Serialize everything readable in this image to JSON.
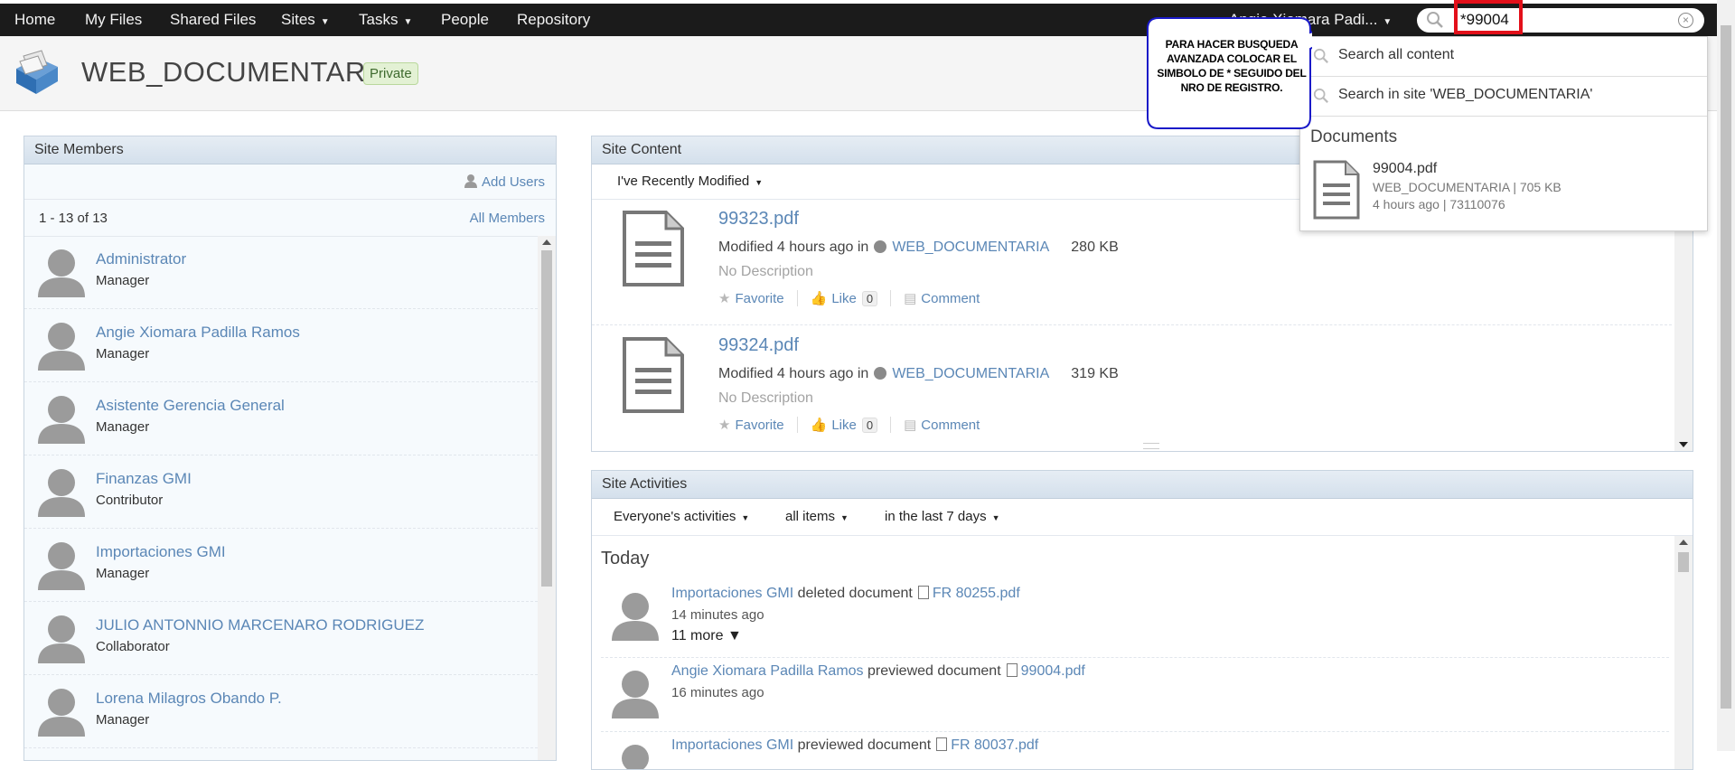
{
  "nav": {
    "items": [
      "Home",
      "My Files",
      "Shared Files",
      "Sites",
      "Tasks",
      "People",
      "Repository"
    ],
    "user_menu": "Angie Xiomara Padi...",
    "search_value": "*99004"
  },
  "site": {
    "title": "WEB_DOCUMENTARIA",
    "visibility": "Private"
  },
  "members": {
    "title": "Site Members",
    "add_users": "Add Users",
    "count": "1 - 13 of 13",
    "all_members": "All Members",
    "list": [
      {
        "name": "Administrator",
        "role": "Manager"
      },
      {
        "name": "Angie Xiomara Padilla Ramos",
        "role": "Manager"
      },
      {
        "name": "Asistente Gerencia General",
        "role": "Manager"
      },
      {
        "name": "Finanzas GMI",
        "role": "Contributor"
      },
      {
        "name": "Importaciones GMI",
        "role": "Manager"
      },
      {
        "name": "JULIO ANTONNIO MARCENARO RODRIGUEZ",
        "role": "Collaborator"
      },
      {
        "name": "Lorena Milagros Obando P.",
        "role": "Manager"
      }
    ]
  },
  "content": {
    "title": "Site Content",
    "filter": "I've Recently Modified",
    "documents": [
      {
        "name": "99323.pdf",
        "modified": "Modified 4 hours ago in",
        "site": "WEB_DOCUMENTARIA",
        "size": "280 KB",
        "description": "No Description",
        "favorite": "Favorite",
        "like": "Like",
        "likes": "0",
        "comment": "Comment"
      },
      {
        "name": "99324.pdf",
        "modified": "Modified 4 hours ago in",
        "site": "WEB_DOCUMENTARIA",
        "size": "319 KB",
        "description": "No Description",
        "favorite": "Favorite",
        "like": "Like",
        "likes": "0",
        "comment": "Comment"
      }
    ]
  },
  "activities": {
    "title": "Site Activities",
    "filters": [
      "Everyone's activities",
      "all items",
      "in the last 7 days"
    ],
    "today": "Today",
    "items": [
      {
        "who": "Importaciones GMI",
        "action": "deleted document",
        "file": "FR 80255.pdf",
        "time": "14 minutes ago",
        "more": "11 more ▼"
      },
      {
        "who": "Angie Xiomara Padilla Ramos",
        "action": "previewed document",
        "file": "99004.pdf",
        "time": "16 minutes ago"
      },
      {
        "who": "Importaciones GMI",
        "action": "previewed document",
        "file": "FR 80037.pdf"
      }
    ]
  },
  "search_dropdown": {
    "all_content": "Search all content",
    "in_site": "Search in site 'WEB_DOCUMENTARIA'",
    "documents_heading": "Documents",
    "result": {
      "name": "99004.pdf",
      "meta1": "WEB_DOCUMENTARIA | 705 KB",
      "meta2": "4 hours ago | 73110076"
    }
  },
  "callout": {
    "text": "PARA HACER BUSQUEDA AVANZADA COLOCAR EL SIMBOLO DE * SEGUIDO DEL NRO DE REGISTRO."
  },
  "colors": {
    "link": "#5b87b6",
    "nav_bg": "#1b1b1b",
    "highlight": "#e3101a",
    "callout_border": "#1a1ac8"
  }
}
